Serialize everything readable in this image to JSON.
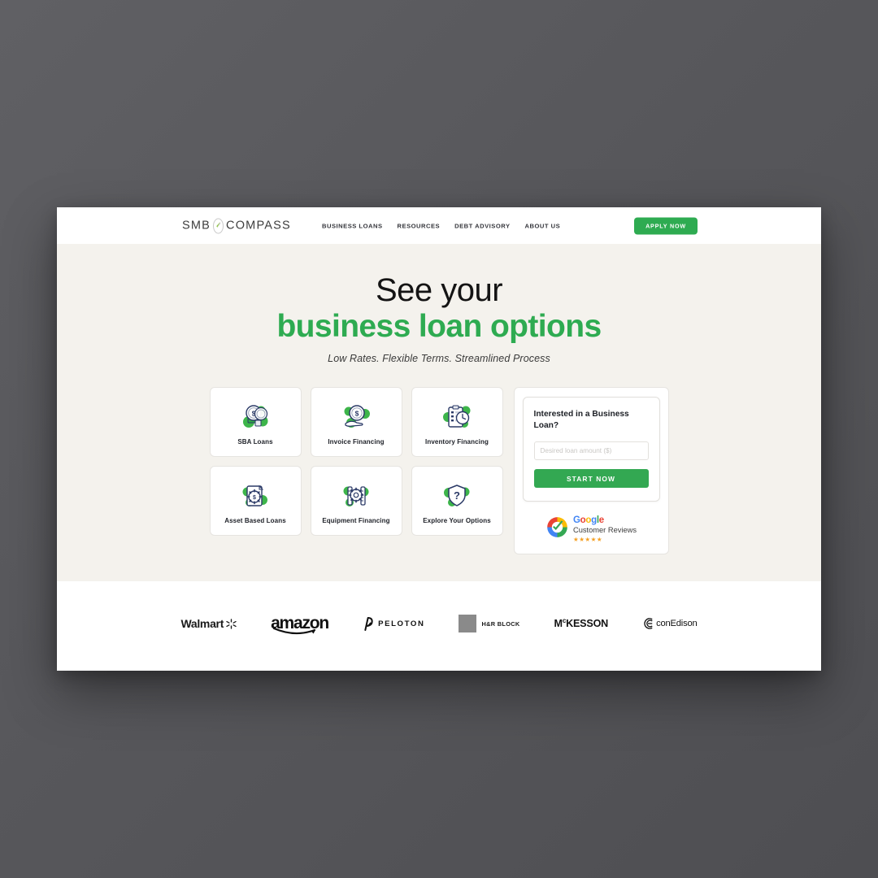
{
  "header": {
    "logo": {
      "left": "SMB",
      "right": "COMPASS",
      "mark_icon": "compass-icon"
    },
    "nav": [
      {
        "label": "BUSINESS LOANS"
      },
      {
        "label": "RESOURCES"
      },
      {
        "label": "DEBT ADVISORY"
      },
      {
        "label": "ABOUT US"
      }
    ],
    "cta_label": "APPLY NOW"
  },
  "hero": {
    "title_line1": "See your",
    "title_line2": "business loan options",
    "subtitle": "Low Rates. Flexible Terms. Streamlined Process",
    "accent_color": "#2eab51",
    "background_color": "#f4f2ed"
  },
  "cards": [
    {
      "label": "SBA Loans",
      "icon": "coins-dollar-icon"
    },
    {
      "label": "Invoice Financing",
      "icon": "hand-coin-icon"
    },
    {
      "label": "Inventory Financing",
      "icon": "clipboard-clock-icon"
    },
    {
      "label": "Asset Based Loans",
      "icon": "document-gear-dollar-icon"
    },
    {
      "label": "Equipment Financing",
      "icon": "gear-tools-icon"
    },
    {
      "label": "Explore Your Options",
      "icon": "shield-question-icon"
    }
  ],
  "form": {
    "title": "Interested in a Business Loan?",
    "input_value": "",
    "input_placeholder": "Desired loan amount ($)",
    "submit_label": "START NOW",
    "submit_color": "#33a852",
    "badge": {
      "google_letters": [
        "G",
        "o",
        "o",
        "g",
        "l",
        "e"
      ],
      "reviews_label": "Customer Reviews",
      "stars": "★★★★★",
      "star_color": "#f4a024"
    }
  },
  "client_logos": [
    {
      "name": "Walmart",
      "label": "Walmart"
    },
    {
      "name": "amazon",
      "label": "amazon"
    },
    {
      "name": "Peloton",
      "label": "PELOTON"
    },
    {
      "name": "H&R Block",
      "label": "H&R BLOCK"
    },
    {
      "name": "McKesson",
      "label": "M",
      "sup": "c",
      "rest": "KESSON"
    },
    {
      "name": "conEdison",
      "label": "conEdison"
    }
  ]
}
